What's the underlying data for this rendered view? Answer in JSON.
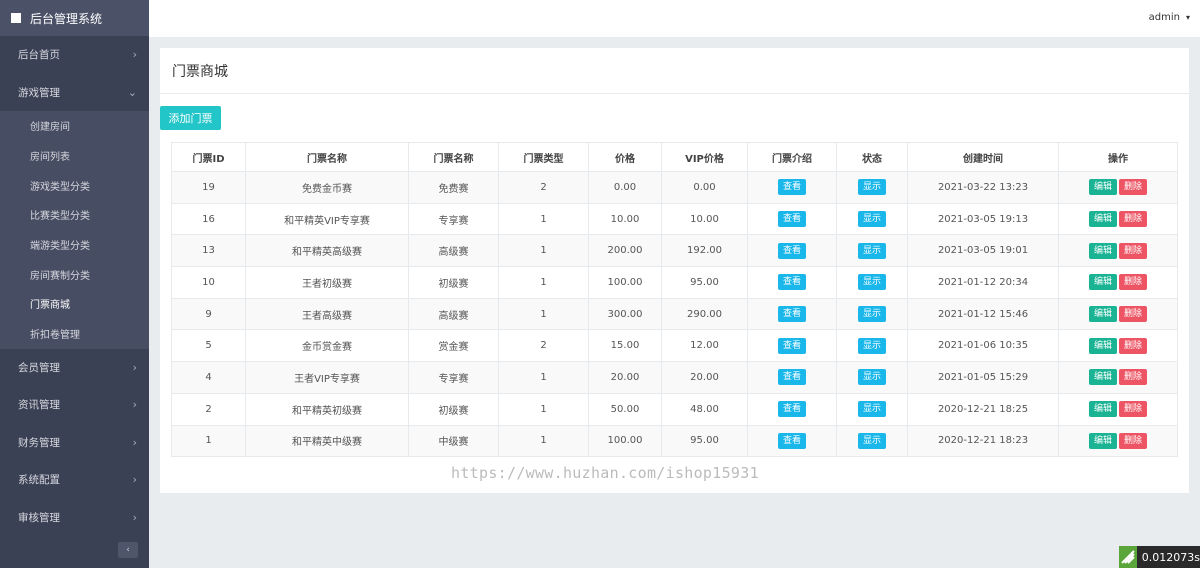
{
  "app": {
    "title": "后台管理系统"
  },
  "header": {
    "user": "admin"
  },
  "sidebar": {
    "items": [
      {
        "label": "后台首页"
      },
      {
        "label": "游戏管理"
      },
      {
        "label": "会员管理"
      },
      {
        "label": "资讯管理"
      },
      {
        "label": "财务管理"
      },
      {
        "label": "系统配置"
      },
      {
        "label": "审核管理"
      }
    ],
    "sub_items": [
      {
        "label": "创建房间"
      },
      {
        "label": "房间列表"
      },
      {
        "label": "游戏类型分类"
      },
      {
        "label": "比赛类型分类"
      },
      {
        "label": "端游类型分类"
      },
      {
        "label": "房间赛制分类"
      },
      {
        "label": "门票商城"
      },
      {
        "label": "折扣卷管理"
      }
    ]
  },
  "page": {
    "title": "门票商城",
    "add_button": "添加门票"
  },
  "table": {
    "headers": [
      "门票ID",
      "门票名称",
      "门票名称",
      "门票类型",
      "价格",
      "VIP价格",
      "门票介绍",
      "状态",
      "创建时间",
      "操作"
    ],
    "view_label": "查看",
    "status_label": "显示",
    "edit_label": "编辑",
    "delete_label": "删除",
    "rows": [
      {
        "id": "19",
        "name": "免费金币赛",
        "name2": "免费赛",
        "type": "2",
        "price": "0.00",
        "vip": "0.00",
        "time": "2021-03-22 13:23"
      },
      {
        "id": "16",
        "name": "和平精英VIP专享赛",
        "name2": "专享赛",
        "type": "1",
        "price": "10.00",
        "vip": "10.00",
        "time": "2021-03-05 19:13"
      },
      {
        "id": "13",
        "name": "和平精英高级赛",
        "name2": "高级赛",
        "type": "1",
        "price": "200.00",
        "vip": "192.00",
        "time": "2021-03-05 19:01"
      },
      {
        "id": "10",
        "name": "王者初级赛",
        "name2": "初级赛",
        "type": "1",
        "price": "100.00",
        "vip": "95.00",
        "time": "2021-01-12 20:34"
      },
      {
        "id": "9",
        "name": "王者高级赛",
        "name2": "高级赛",
        "type": "1",
        "price": "300.00",
        "vip": "290.00",
        "time": "2021-01-12 15:46"
      },
      {
        "id": "5",
        "name": "金币赏金赛",
        "name2": "赏金赛",
        "type": "2",
        "price": "15.00",
        "vip": "12.00",
        "time": "2021-01-06 10:35"
      },
      {
        "id": "4",
        "name": "王者VIP专享赛",
        "name2": "专享赛",
        "type": "1",
        "price": "20.00",
        "vip": "20.00",
        "time": "2021-01-05 15:29"
      },
      {
        "id": "2",
        "name": "和平精英初级赛",
        "name2": "初级赛",
        "type": "1",
        "price": "50.00",
        "vip": "48.00",
        "time": "2020-12-21 18:25"
      },
      {
        "id": "1",
        "name": "和平精英中级赛",
        "name2": "中级赛",
        "type": "1",
        "price": "100.00",
        "vip": "95.00",
        "time": "2020-12-21 18:23"
      }
    ]
  },
  "watermark": "https://www.huzhan.com/ishop15931",
  "timer": "0.012073s",
  "colors": {
    "sidebar": "#3b4155",
    "accent": "#23c6c8",
    "danger": "#ed5565",
    "success": "#1ab394",
    "info": "#1ab7ea"
  }
}
